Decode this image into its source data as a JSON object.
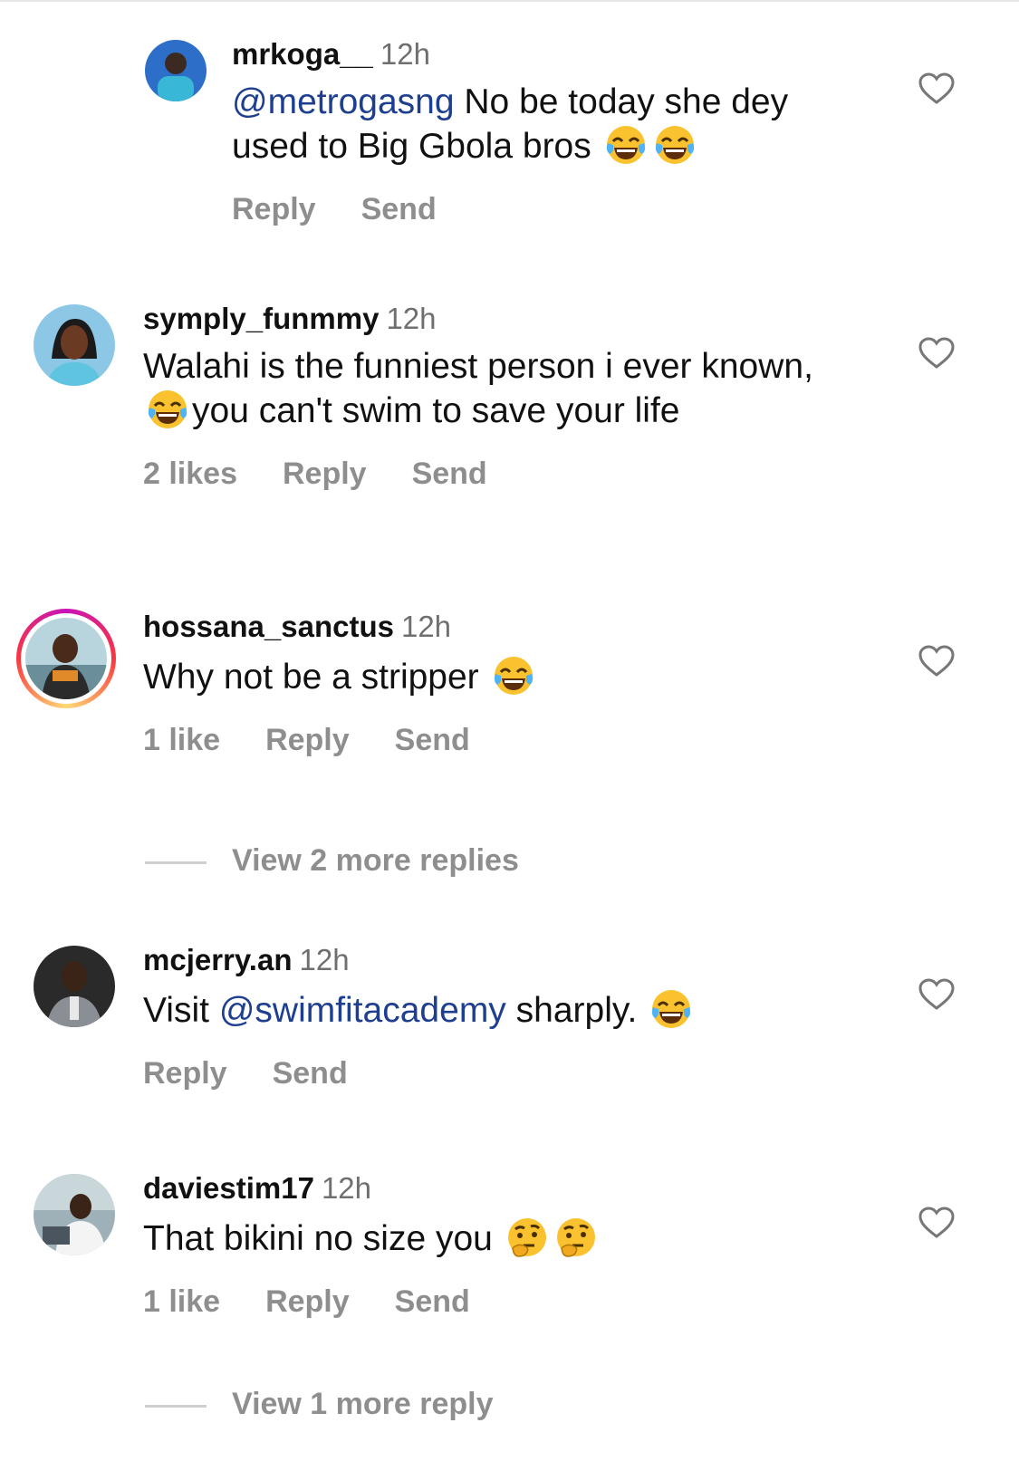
{
  "comments": [
    {
      "username": "mrkoga__",
      "time": "12h",
      "mention": "@metrogasng",
      "text_after": " No be today she dey used to Big Gbola bros ",
      "emojis": [
        "face-with-tears-of-joy",
        "face-with-tears-of-joy"
      ],
      "reply": "Reply",
      "send": "Send"
    },
    {
      "username": "symply_funmmy",
      "time": "12h",
      "text_a": "Walahi is the funniest person i ever known,",
      "text_b": "you can't swim to save your life",
      "emojis": [
        "face-with-tears-of-joy"
      ],
      "likes": "2 likes",
      "reply": "Reply",
      "send": "Send"
    },
    {
      "username": "hossana_sanctus",
      "time": "12h",
      "text": "Why not be a stripper ",
      "emojis": [
        "face-with-tears-of-joy"
      ],
      "likes": "1 like",
      "reply": "Reply",
      "send": "Send",
      "view_more": "View 2 more replies"
    },
    {
      "username": "mcjerry.an",
      "time": "12h",
      "text_before": "Visit ",
      "mention": "@swimfitacademy",
      "text_after": " sharply. ",
      "emojis": [
        "face-with-tears-of-joy"
      ],
      "reply": "Reply",
      "send": "Send"
    },
    {
      "username": "daviestim17",
      "time": "12h",
      "text": "That bikini no size you ",
      "emojis": [
        "thinking-face",
        "thinking-face"
      ],
      "likes": "1 like",
      "reply": "Reply",
      "send": "Send",
      "view_more": "View 1 more reply"
    }
  ],
  "colors": {
    "mention": "#1e3f8f",
    "muted": "#8e8e8e",
    "story_ring": "#c913b9"
  }
}
